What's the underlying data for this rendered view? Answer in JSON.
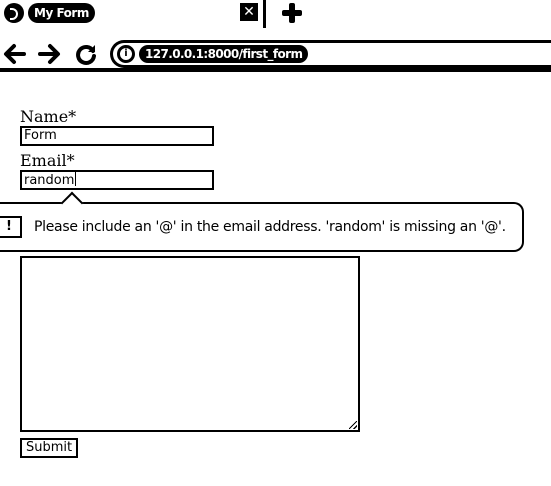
{
  "browser": {
    "tab": {
      "title": "My Form",
      "close_glyph": "✕",
      "favicon": "django-icon"
    },
    "new_tab_icon": "plus-icon",
    "address_bar": {
      "url": "127.0.0.1:8000/first_form",
      "site_info_glyph": "i"
    }
  },
  "form": {
    "name_label": "Name*",
    "name_value": "Form",
    "email_label": "Email*",
    "email_value": "random",
    "submit_label": "Submit"
  },
  "validation": {
    "icon_glyph": "!",
    "message": "Please include an '@' in the email address. 'random' is missing an '@'."
  }
}
